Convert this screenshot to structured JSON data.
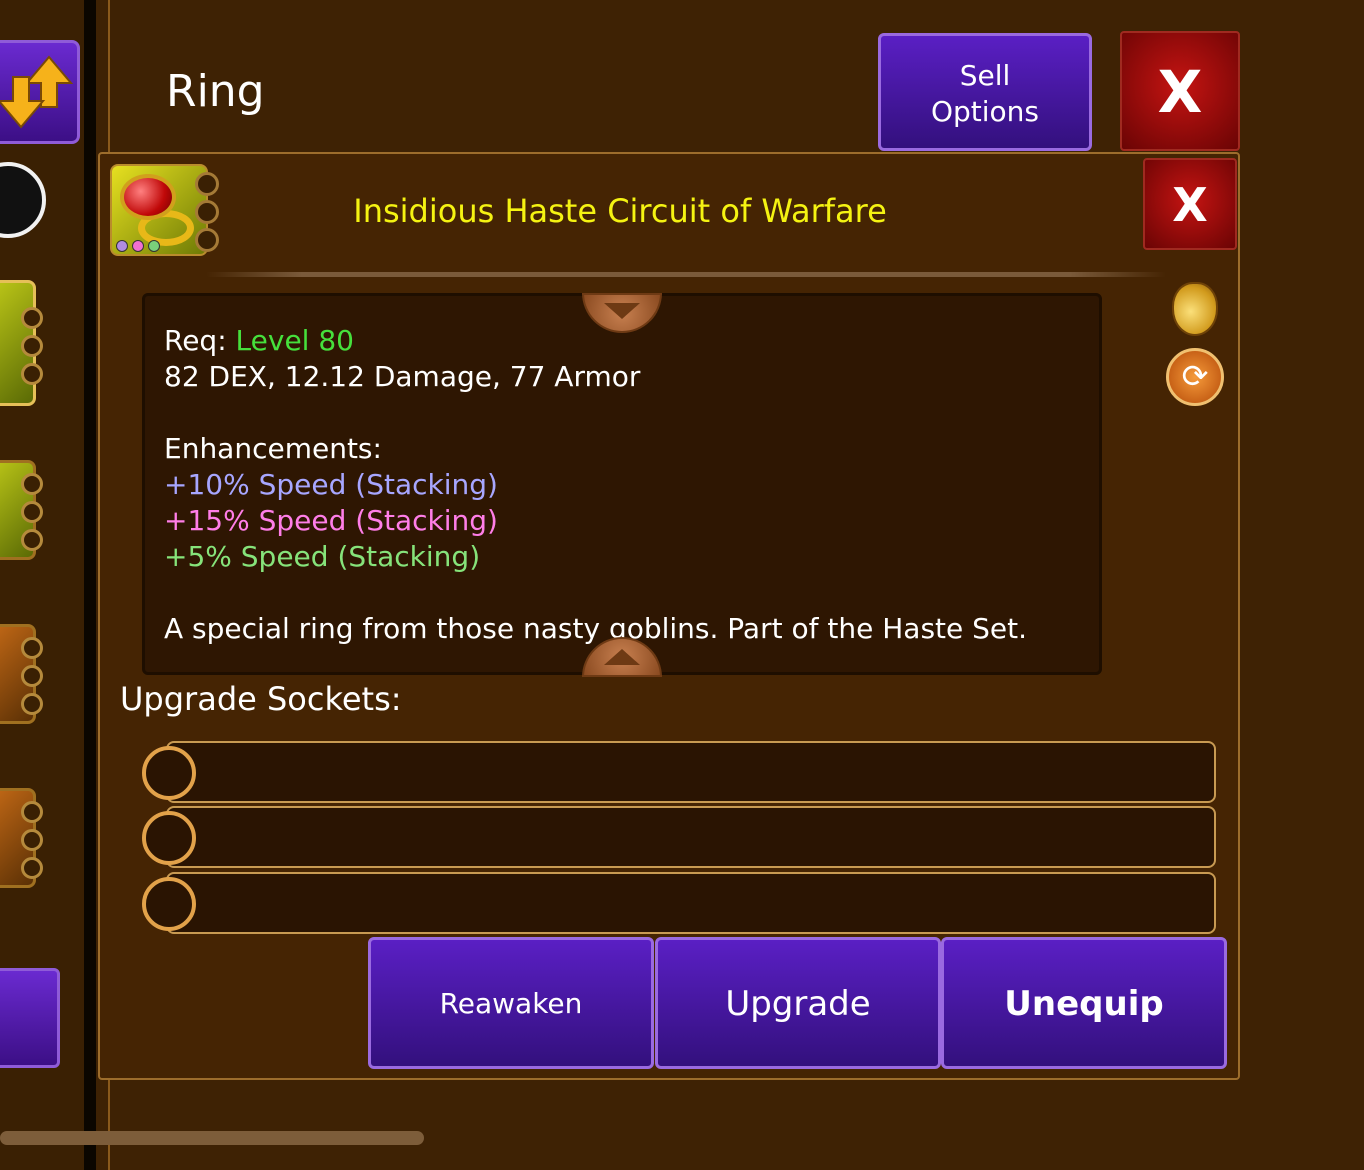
{
  "header": {
    "title": "Ring",
    "sell_options_label": "Sell\nOptions",
    "close_label": "X"
  },
  "item": {
    "name": "Insidious Haste Circuit of Warfare",
    "close_label": "X",
    "req_label": "Req:",
    "req_value": "Level 80",
    "stats": "82 DEX, 12.12 Damage, 77 Armor",
    "enhancements_title": "Enhancements:",
    "enhancements": [
      "+10% Speed (Stacking)",
      "+15% Speed (Stacking)",
      "+5% Speed (Stacking)"
    ],
    "description": "A special ring from those nasty goblins. Part of the Haste Set."
  },
  "sockets": {
    "label": "Upgrade Sockets:",
    "count": 3
  },
  "actions": {
    "reawaken": "Reawaken",
    "upgrade": "Upgrade",
    "unequip": "Unequip"
  },
  "colors": {
    "background": "#3e2204",
    "panel": "#452403",
    "item_name": "#f5f312",
    "req_level": "#46e03c",
    "enh_1": "#a7a6ff",
    "enh_2": "#ff7ee8",
    "enh_3": "#86e37a",
    "button_purple": "#4a18a8",
    "button_red": "#b01010"
  },
  "icons": {
    "sort": "sort-arrows-icon",
    "item": "ring-icon",
    "sell": "money-bag-icon",
    "swap": "swap-icon"
  }
}
